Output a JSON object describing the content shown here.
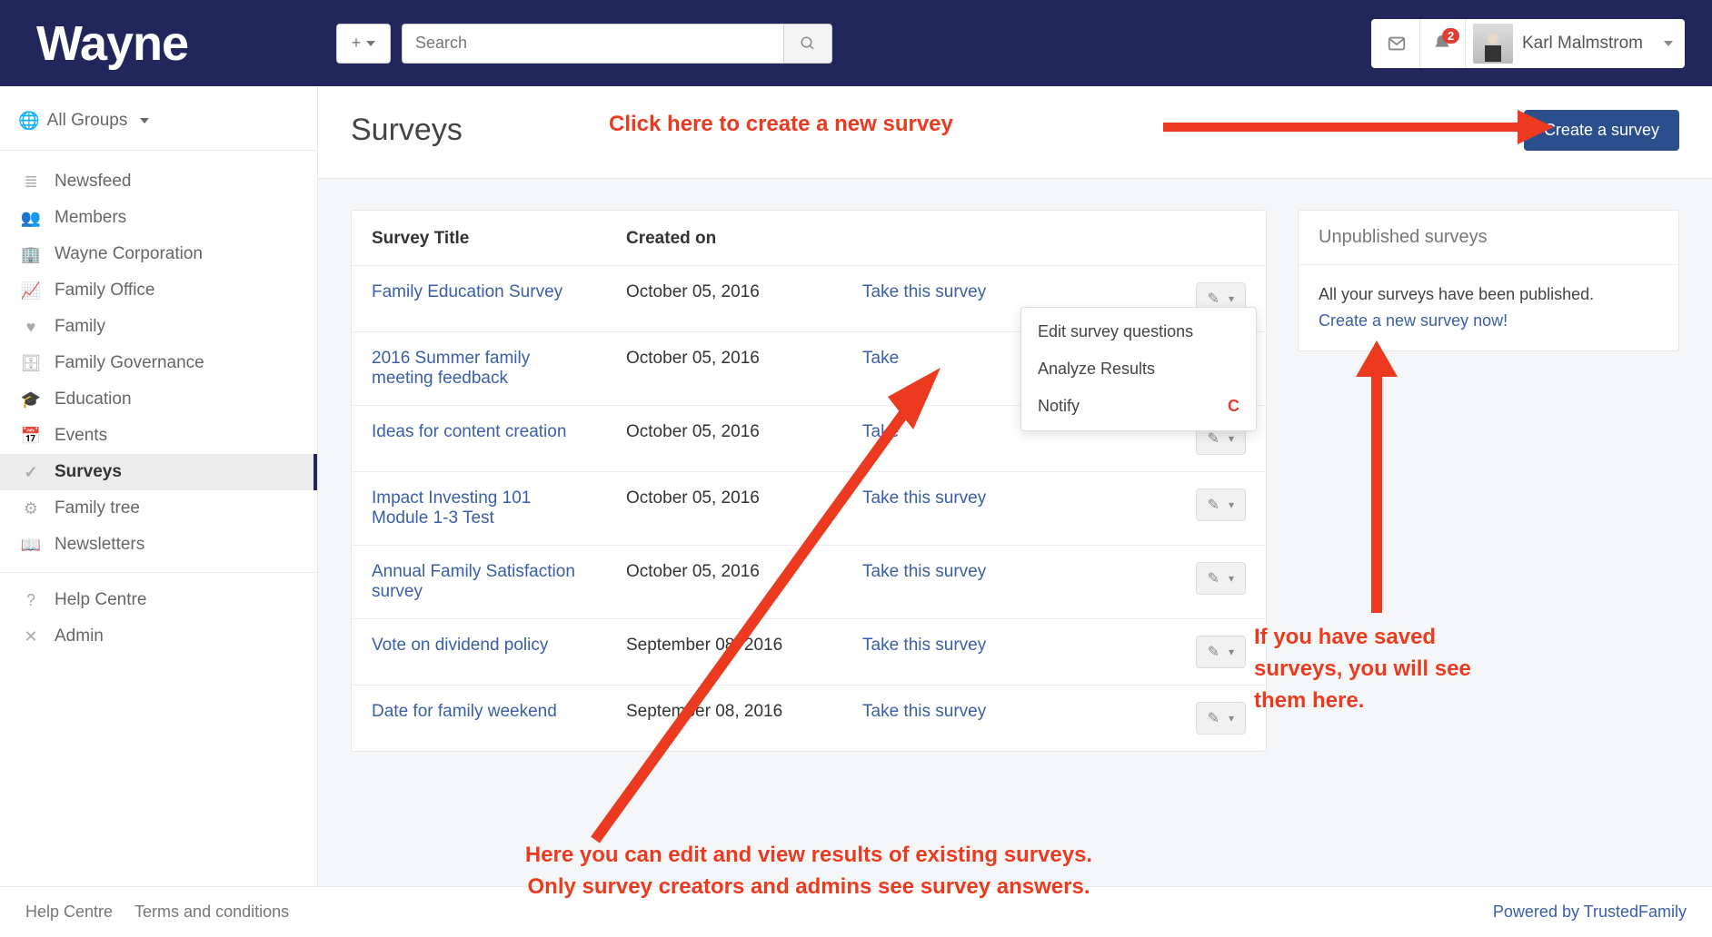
{
  "brand": "Wayne",
  "topbar": {
    "add_label": "+",
    "search_placeholder": "Search",
    "notification_count": "2",
    "username": "Karl Malmstrom"
  },
  "sidebar": {
    "groups_label": "All Groups",
    "items": [
      {
        "icon": "≣",
        "label": "Newsfeed"
      },
      {
        "icon": "👥",
        "label": "Members"
      },
      {
        "icon": "🏢",
        "label": "Wayne Corporation"
      },
      {
        "icon": "📈",
        "label": "Family Office"
      },
      {
        "icon": "♥",
        "label": "Family"
      },
      {
        "icon": "🗄",
        "label": "Family Governance"
      },
      {
        "icon": "🎓",
        "label": "Education"
      },
      {
        "icon": "📅",
        "label": "Events"
      },
      {
        "icon": "✓",
        "label": "Surveys",
        "active": true
      },
      {
        "icon": "⚙",
        "label": "Family tree"
      },
      {
        "icon": "📖",
        "label": "Newsletters"
      }
    ],
    "footer_items": [
      {
        "icon": "?",
        "label": "Help Centre"
      },
      {
        "icon": "✕",
        "label": "Admin"
      }
    ]
  },
  "page": {
    "title": "Surveys",
    "create_button": "Create a survey"
  },
  "table": {
    "headers": {
      "title": "Survey Title",
      "created": "Created on"
    },
    "take_label": "Take this survey",
    "rows": [
      {
        "title": "Family Education Survey",
        "created": "October 05, 2016",
        "take_visible": "Take this survey"
      },
      {
        "title": "2016 Summer family meeting feedback",
        "created": "October 05, 2016",
        "take_visible": "Take"
      },
      {
        "title": "Ideas for content creation",
        "created": "October 05, 2016",
        "take_visible": "Take"
      },
      {
        "title": "Impact Investing 101 Module 1-3 Test",
        "created": "October 05, 2016",
        "take_visible": "Take this survey"
      },
      {
        "title": "Annual Family Satisfaction survey",
        "created": "October 05, 2016",
        "take_visible": "Take this survey"
      },
      {
        "title": "Vote on dividend policy",
        "created": "September 08, 2016",
        "take_visible": "Take this survey"
      },
      {
        "title": "Date for family weekend",
        "created": "September 08, 2016",
        "take_visible": "Take this survey"
      }
    ]
  },
  "dropdown": {
    "items": [
      {
        "label": "Edit survey questions",
        "shortcut": ""
      },
      {
        "label": "Analyze Results",
        "shortcut": ""
      },
      {
        "label": "Notify",
        "shortcut": "C"
      }
    ]
  },
  "unpublished": {
    "heading": "Unpublished surveys",
    "text": "All your surveys have been published.",
    "link": "Create a new survey now!"
  },
  "footer": {
    "help": "Help Centre",
    "terms": "Terms and conditions",
    "powered": "Powered by TrustedFamily"
  },
  "annotations": {
    "create": "Click here to create a new survey",
    "dropdown": "Here you can edit and view results of existing surveys.\nOnly survey creators and admins see survey answers.",
    "unpublished": "If you have saved surveys, you will see them here."
  }
}
